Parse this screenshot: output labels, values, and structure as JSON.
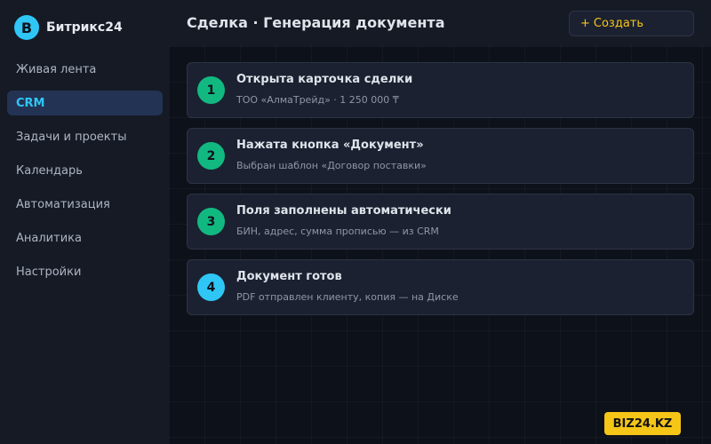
{
  "app": {
    "logo_letter": "B",
    "name": "Битрикс24"
  },
  "sidebar": {
    "items": [
      {
        "label": "Живая лента",
        "active": false
      },
      {
        "label": "CRM",
        "active": true
      },
      {
        "label": "Задачи и проекты",
        "active": false
      },
      {
        "label": "Календарь",
        "active": false
      },
      {
        "label": "Автоматизация",
        "active": false
      },
      {
        "label": "Аналитика",
        "active": false
      },
      {
        "label": "Настройки",
        "active": false
      }
    ]
  },
  "header": {
    "title": "Сделка · Генерация документа",
    "create_icon": "+",
    "create_label": "Создать"
  },
  "steps": [
    {
      "number": "1",
      "title": "Открыта карточка сделки",
      "subtitle": "ТОО «АлмаТрейд» · 1 250 000 ₸",
      "color": "#11b981"
    },
    {
      "number": "2",
      "title": "Нажата кнопка «Документ»",
      "subtitle": "Выбран шаблон «Договор поставки»",
      "color": "#11b981"
    },
    {
      "number": "3",
      "title": "Поля заполнены автоматически",
      "subtitle": "БИН, адрес, сумма прописью — из CRM",
      "color": "#11b981"
    },
    {
      "number": "4",
      "title": "Документ готов",
      "subtitle": "PDF отправлен клиенту, копия — на Диске",
      "color": "#2fc6f6"
    }
  ],
  "brand": {
    "label": "BIZ24.KZ"
  },
  "colors": {
    "accent": "#2fc6f6",
    "success": "#11b981",
    "brand": "#f5c518"
  }
}
